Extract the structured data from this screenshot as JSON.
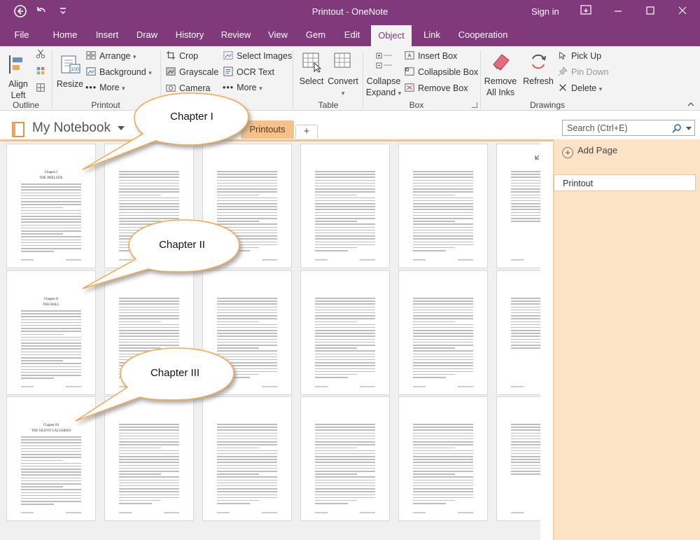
{
  "window": {
    "title": "Printout  -  OneNote",
    "sign_in": "Sign in",
    "minimize": "—",
    "maximize": "☐",
    "close": "✕"
  },
  "quick_access": {
    "back": "◀",
    "undo": "↶",
    "more": "▾"
  },
  "tabs": [
    {
      "label": "File"
    },
    {
      "label": "Home"
    },
    {
      "label": "Insert"
    },
    {
      "label": "Draw"
    },
    {
      "label": "History"
    },
    {
      "label": "Review"
    },
    {
      "label": "View"
    },
    {
      "label": "Gem"
    },
    {
      "label": "Edit"
    },
    {
      "label": "Object"
    },
    {
      "label": "Link"
    },
    {
      "label": "Cooperation"
    }
  ],
  "active_tab": "Object",
  "ribbon": {
    "align_left": "Align\nLeft",
    "align_left_l1": "Align",
    "align_left_l2": "Left",
    "resize": "Resize",
    "arrange": "Arrange",
    "background": "Background",
    "more1": "More",
    "crop": "Crop",
    "grayscale": "Grayscale",
    "camera": "Camera",
    "select_images": "Select Images",
    "ocr_text": "OCR Text",
    "more2": "More",
    "select": "Select",
    "convert": "Convert",
    "collapse_expand_l1": "Collapse",
    "collapse_expand_l2": "Expand",
    "insert_box": "Insert Box",
    "collapsible_box": "Collapsible Box",
    "remove_box": "Remove Box",
    "remove_all_inks_l1": "Remove",
    "remove_all_inks_l2": "All Inks",
    "refresh": "Refresh",
    "pick_up": "Pick Up",
    "pin_down": "Pin Down",
    "delete": "Delete",
    "groups": {
      "outline": "Outline",
      "printout": "Printout",
      "table": "Table",
      "box": "Box",
      "drawings": "Drawings"
    }
  },
  "notebook": {
    "name": "My Notebook",
    "section": "Printouts",
    "add_section": "+",
    "search_placeholder": "Search (Ctrl+E)"
  },
  "pages_panel": {
    "add_page": "Add Page",
    "pages": [
      {
        "title": "Printout"
      }
    ]
  },
  "callouts": [
    {
      "text": "Chapter I"
    },
    {
      "text": "Chapter II"
    },
    {
      "text": "Chapter III"
    }
  ],
  "printout_pages": [
    {
      "chapter": "Chapter I",
      "subtitle": "THE PRELUDE"
    },
    {
      "chapter": "Chapter II",
      "subtitle": "THE BALL"
    },
    {
      "chapter": "Chapter III",
      "subtitle": "THE SILENT GALLERIES"
    }
  ],
  "colors": {
    "brand": "#80397b",
    "section_tab": "#f5c08a",
    "page_panel": "#fde3c6"
  }
}
